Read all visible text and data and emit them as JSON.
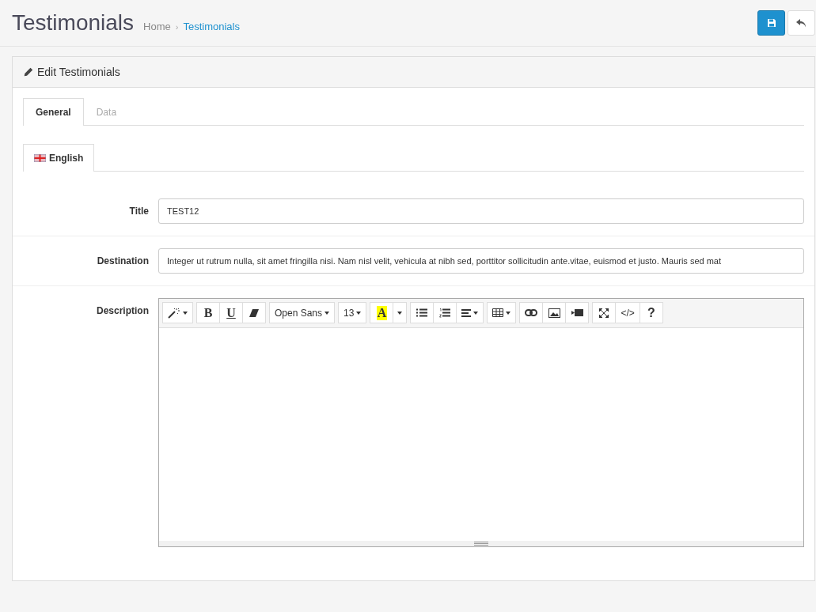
{
  "header": {
    "title": "Testimonials",
    "separator": "›",
    "breadcrumb": [
      {
        "label": "Home",
        "current": false
      },
      {
        "label": "Testimonials",
        "current": true
      }
    ]
  },
  "panel": {
    "title": "Edit Testimonials"
  },
  "tabs": [
    {
      "label": "General",
      "selected": true
    },
    {
      "label": "Data",
      "selected": false
    }
  ],
  "languages": [
    {
      "label": "English",
      "selected": true
    }
  ],
  "fields": [
    {
      "kind": "input",
      "label": "Title",
      "value": "TEST12"
    },
    {
      "kind": "input",
      "label": "Destination",
      "value": "Integer ut rutrum nulla, sit amet fringilla nisi. Nam nisl velit, vehicula at nibh sed, porttitor sollicitudin ante.vitae, euismod et justo. Mauris sed mat"
    },
    {
      "kind": "editor",
      "label": "Description"
    }
  ],
  "toolbar": [
    [
      {
        "kind": "wand",
        "caret": true
      }
    ],
    [
      {
        "kind": "bold",
        "text": "B"
      },
      {
        "kind": "underline",
        "text": "U"
      },
      {
        "kind": "eraser"
      }
    ],
    [
      {
        "kind": "font",
        "text": "Open Sans",
        "caret": true
      }
    ],
    [
      {
        "kind": "size",
        "text": "13",
        "caret": true
      }
    ],
    [
      {
        "kind": "highlight",
        "text": "A"
      },
      {
        "kind": "dropdown",
        "caret": true
      }
    ],
    [
      {
        "kind": "ul"
      },
      {
        "kind": "ol"
      },
      {
        "kind": "align",
        "caret": true
      }
    ],
    [
      {
        "kind": "table",
        "caret": true
      }
    ],
    [
      {
        "kind": "link"
      },
      {
        "kind": "picture"
      },
      {
        "kind": "video"
      }
    ],
    [
      {
        "kind": "expand"
      },
      {
        "kind": "code",
        "text": "</>"
      },
      {
        "kind": "help",
        "text": "?"
      }
    ]
  ]
}
